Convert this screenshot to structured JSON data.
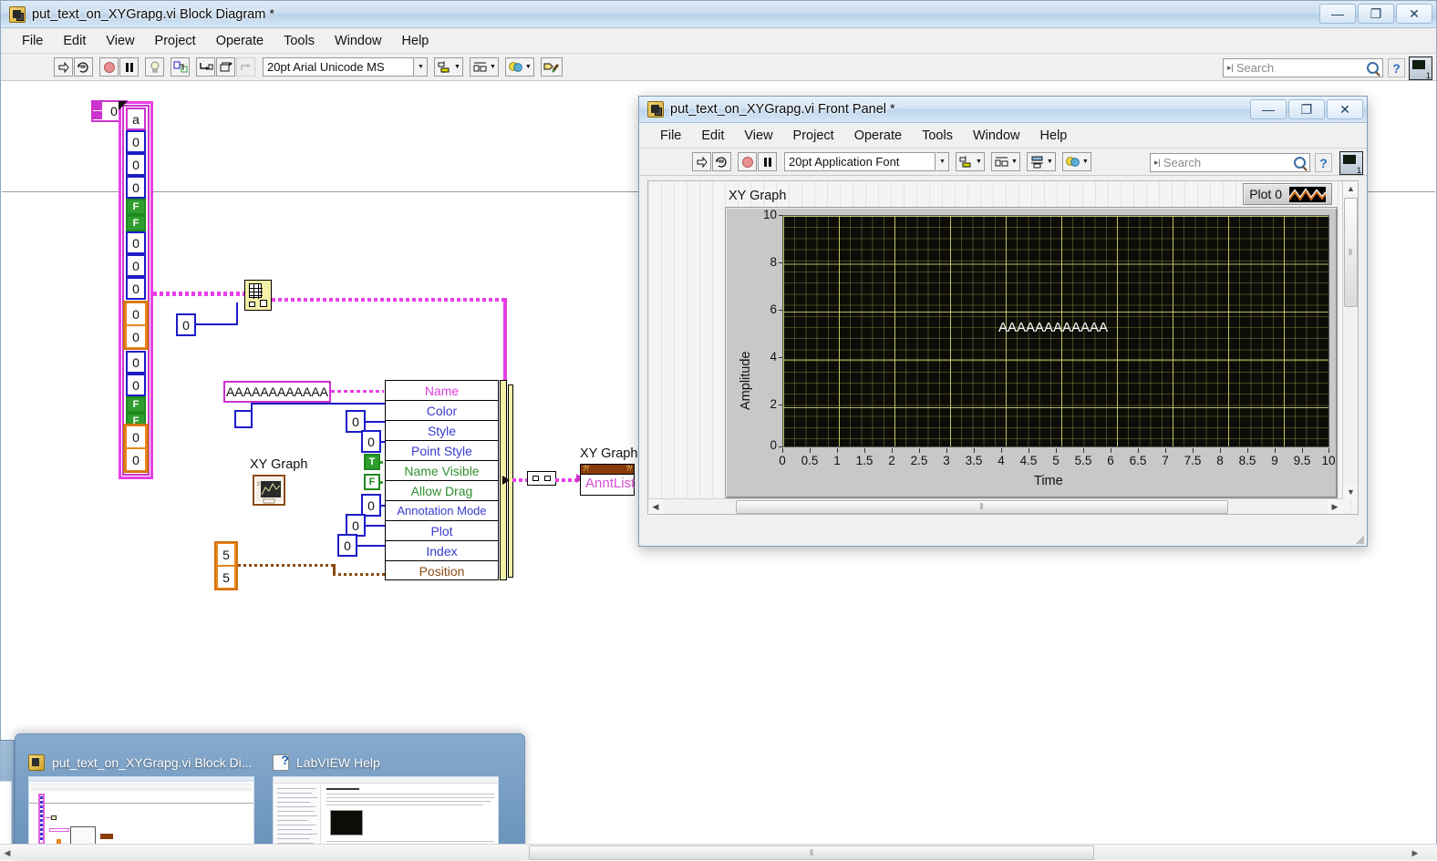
{
  "block_diagram_window": {
    "title": "put_text_on_XYGrapg.vi Block Diagram *",
    "icon": "labview-vi-icon",
    "window_buttons": {
      "minimize": "—",
      "maximize": "❐",
      "close": "✕"
    },
    "menu": [
      "File",
      "Edit",
      "View",
      "Project",
      "Operate",
      "Tools",
      "Window",
      "Help"
    ],
    "toolbar": {
      "run": "run-arrow-icon",
      "run_continuously": "run-continuously-icon",
      "abort": "abort-execution-icon",
      "pause": "pause-icon",
      "highlight_execution": "lightbulb-icon",
      "retain_wire_values": "retain-wire-values-icon",
      "step_into": "step-into-icon",
      "step_over": "step-over-icon",
      "step_out": "step-out-icon",
      "font": "20pt Arial Unicode MS",
      "align_objects": "align-objects-icon",
      "distribute_objects": "distribute-objects-icon",
      "reorder": "reorder-icon",
      "clean_up_diagram": "clean-up-diagram-icon",
      "search_placeholder": "Search",
      "help_button": "?",
      "lv_logo_badge": "1"
    },
    "canvas": {
      "numeric_control": {
        "value": "0",
        "name": "numeric-control"
      },
      "array_label_cell": "a",
      "array_cells": [
        "0",
        "0",
        "0",
        "F",
        "F",
        "0",
        "0",
        "0",
        "0",
        "0",
        "0",
        "0",
        "F",
        "F",
        "0",
        "0",
        "0"
      ],
      "index_array_constant": "0",
      "index_array_node": "index-array-node",
      "string_constant": "AAAAAAAAAAAA",
      "color_box_constant": "",
      "xy_graph_terminal_label": "XY Graph",
      "bundle_fields": [
        {
          "label": "Name",
          "color": "#e040e0",
          "input": ""
        },
        {
          "label": "Color",
          "color": "#3a3ad0",
          "input": ""
        },
        {
          "label": "Style",
          "color": "#3a3ad0",
          "input": "0"
        },
        {
          "label": "Point Style",
          "color": "#3a3ad0",
          "input": "0"
        },
        {
          "label": "Name Visible",
          "color": "#2f8f2f",
          "input": "T"
        },
        {
          "label": "Allow Drag",
          "color": "#2f8f2f",
          "input": "F"
        },
        {
          "label": "Annotation Mode",
          "color": "#3a3ad0",
          "input": "0"
        },
        {
          "label": "Plot",
          "color": "#3a3ad0",
          "input": "0"
        },
        {
          "label": "Index",
          "color": "#3a3ad0",
          "input": "0"
        },
        {
          "label": "Position",
          "color": "#8a4b10",
          "input": ""
        }
      ],
      "position_cluster": [
        "5",
        "5"
      ],
      "property_node": {
        "reference_label": "XY Graph",
        "property": "AnntList"
      }
    }
  },
  "front_panel_window": {
    "title": "put_text_on_XYGrapg.vi Front Panel *",
    "icon": "labview-vi-icon",
    "window_buttons": {
      "minimize": "—",
      "maximize": "❐",
      "close": "✕"
    },
    "menu": [
      "File",
      "Edit",
      "View",
      "Project",
      "Operate",
      "Tools",
      "Window",
      "Help"
    ],
    "toolbar": {
      "run": "run-arrow-icon",
      "run_continuously": "run-continuously-icon",
      "abort": "abort-execution-icon",
      "pause": "pause-icon",
      "font": "20pt Application Font",
      "align_objects": "align-objects-icon",
      "distribute_objects": "distribute-objects-icon",
      "resize_objects": "resize-objects-icon",
      "reorder": "reorder-icon",
      "search_placeholder": "Search",
      "help_button": "?",
      "lv_logo_badge": "1"
    },
    "graph": {
      "label": "XY Graph",
      "legend": {
        "plot_name": "Plot 0",
        "swatch": "plot-swatch-icon"
      },
      "annotation_text": "AAAAAAAAAAAA"
    },
    "scrollbars": {
      "h_thumb": "⦀",
      "v_up": "▲",
      "v_down": "▼",
      "h_left": "◀",
      "h_right": "▶"
    }
  },
  "chart_data": {
    "type": "scatter",
    "title": "XY Graph",
    "xlabel": "Time",
    "ylabel": "Amplitude",
    "xlim": [
      0,
      10
    ],
    "ylim": [
      0,
      10
    ],
    "x_ticks": [
      "0",
      "0.5",
      "1",
      "1.5",
      "2",
      "2.5",
      "3",
      "3.5",
      "4",
      "4.5",
      "5",
      "5.5",
      "6",
      "6.5",
      "7",
      "7.5",
      "8",
      "8.5",
      "9",
      "9.5",
      "10"
    ],
    "y_ticks": [
      "0",
      "2",
      "4",
      "6",
      "8",
      "10"
    ],
    "grid": true,
    "grid_color": "#d6d66e",
    "plot_background": "#0d0d08",
    "legend_position": "top-right",
    "series": [
      {
        "name": "Plot 0",
        "x": [],
        "y": []
      }
    ],
    "annotations": [
      {
        "text": "AAAAAAAAAAAA",
        "x": 5,
        "y": 5,
        "color": "#ffffff",
        "name_visible": true,
        "allow_drag": false
      }
    ]
  },
  "taskbar": {
    "items": [
      {
        "label": "put_text_on_XYGrapg.vi Block Di...",
        "icon": "labview-vi-icon"
      },
      {
        "label": "LabVIEW Help",
        "icon": "help-document-icon"
      }
    ],
    "scroll_thumb": "⦀"
  }
}
